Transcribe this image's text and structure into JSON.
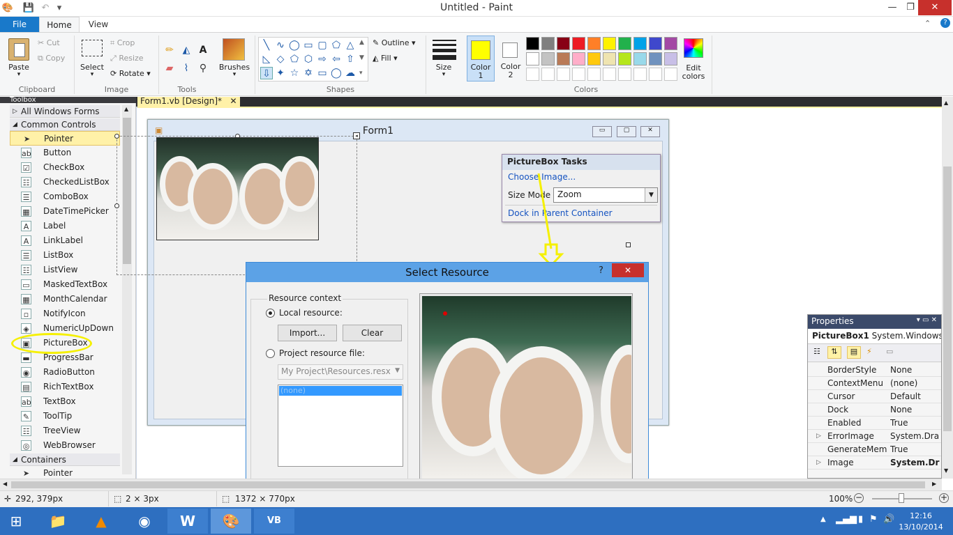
{
  "window": {
    "title": "Untitled - Paint",
    "min": "—",
    "max": "❐",
    "close": "✕"
  },
  "ribbon_tabs": {
    "file": "File",
    "home": "Home",
    "view": "View"
  },
  "ribbon": {
    "clipboard": {
      "paste": "Paste",
      "cut": "Cut",
      "copy": "Copy",
      "group": "Clipboard"
    },
    "image": {
      "select": "Select",
      "crop": "Crop",
      "resize": "Resize",
      "rotate": "Rotate",
      "group": "Image"
    },
    "tools": {
      "group": "Tools"
    },
    "brushes": {
      "label": "Brushes"
    },
    "shapes": {
      "outline": "Outline",
      "fill": "Fill",
      "group": "Shapes"
    },
    "size": {
      "label": "Size"
    },
    "color1": {
      "label": "Color",
      "num": "1"
    },
    "color2": {
      "label": "Color",
      "num": "2"
    },
    "colors": {
      "group": "Colors",
      "edit1": "Edit",
      "edit2": "colors"
    },
    "palette_row1": [
      "#000000",
      "#7f7f7f",
      "#880015",
      "#ed1c24",
      "#ff7f27",
      "#fff200",
      "#22b14c",
      "#00a2e8",
      "#3f48cc",
      "#a349a4"
    ],
    "palette_row2": [
      "#ffffff",
      "#c3c3c3",
      "#b97a57",
      "#ffaec9",
      "#ffc90e",
      "#efe4b0",
      "#b5e61d",
      "#99d9ea",
      "#7092be",
      "#c8bfe7"
    ],
    "color1_value": "#ffff00",
    "color2_value": "#ffffff"
  },
  "vs": {
    "tab": "Form1.vb [Design]*",
    "tab_close": "✕",
    "toolbox_title": "Toolbox",
    "cat_all": "All Windows Forms",
    "cat_common": "Common Controls",
    "cat_containers": "Containers",
    "items": [
      "Pointer",
      "Button",
      "CheckBox",
      "CheckedListBox",
      "ComboBox",
      "DateTimePicker",
      "Label",
      "LinkLabel",
      "ListBox",
      "ListView",
      "MaskedTextBox",
      "MonthCalendar",
      "NotifyIcon",
      "NumericUpDown",
      "PictureBox",
      "ProgressBar",
      "RadioButton",
      "RichTextBox",
      "TextBox",
      "ToolTip",
      "TreeView",
      "WebBrowser"
    ],
    "item_icons": [
      "➤",
      "ab",
      "☑",
      "☷",
      "☰",
      "▦",
      "A",
      "A",
      "☰",
      "☷",
      "▭",
      "▦",
      "▫",
      "◈",
      "▣",
      "▬",
      "◉",
      "▤",
      "ab",
      "✎",
      "☷",
      "◎"
    ],
    "container_pointer": "Pointer",
    "form_title": "Form1",
    "tasks": {
      "title": "PictureBox Tasks",
      "choose": "Choose Image...",
      "sizemode_label": "Size Mode",
      "sizemode_value": "Zoom",
      "dock": "Dock in Parent Container"
    },
    "dialog": {
      "title": "Select Resource",
      "help": "?",
      "close": "✕",
      "context": "Resource context",
      "local": "Local resource:",
      "import": "Import...",
      "clear": "Clear",
      "project": "Project resource file:",
      "resx": "My Project\\Resources.resx",
      "none": "(none)"
    },
    "props": {
      "title": "Properties",
      "object": "PictureBox1",
      "object_type": "System.Windows.Fo",
      "rows": [
        {
          "name": "BorderStyle",
          "value": "None"
        },
        {
          "name": "ContextMenu",
          "value": "(none)"
        },
        {
          "name": "Cursor",
          "value": "Default"
        },
        {
          "name": "Dock",
          "value": "None"
        },
        {
          "name": "Enabled",
          "value": "True"
        },
        {
          "name": "ErrorImage",
          "value": "System.Dra"
        },
        {
          "name": "GenerateMem",
          "value": "True"
        },
        {
          "name": "Image",
          "value": "System.Dr"
        }
      ]
    }
  },
  "status": {
    "cursor_pos": "292, 379px",
    "selection": "2 × 3px",
    "image_size": "1372 × 770px",
    "zoom": "100%"
  },
  "taskbar": {
    "time": "12:16",
    "date": "13/10/2014"
  }
}
